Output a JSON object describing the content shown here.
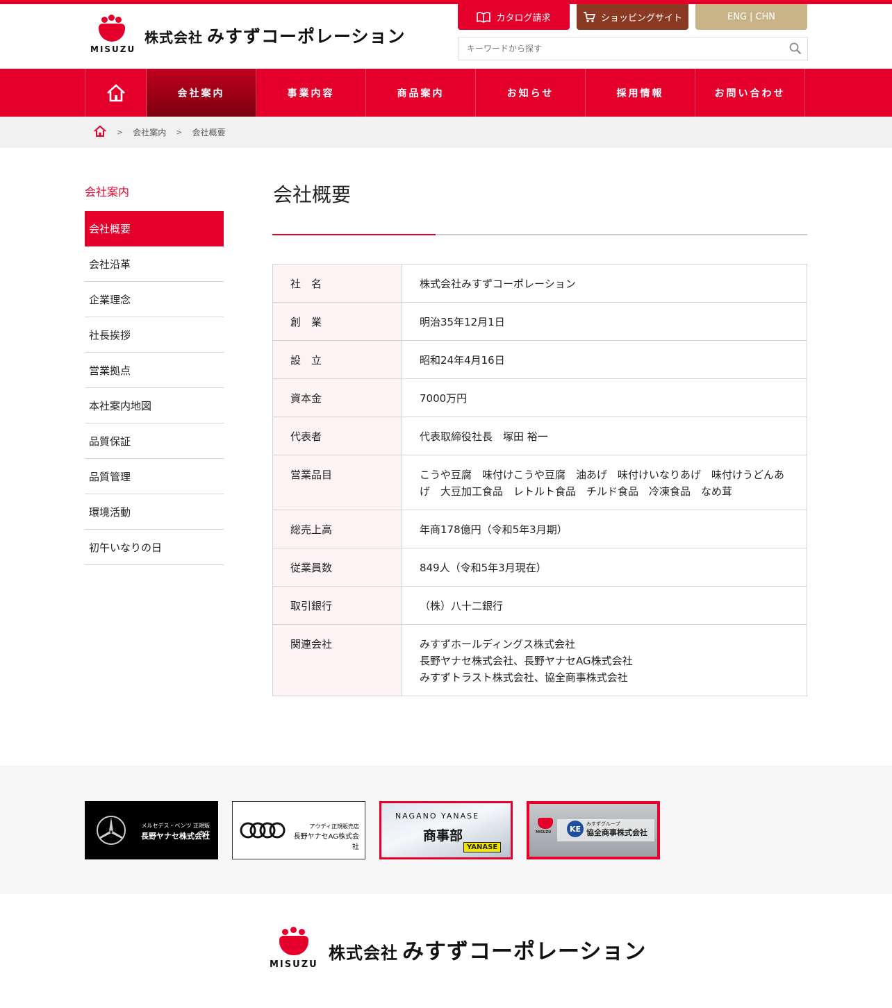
{
  "brand": {
    "mark_word": "MISUZU",
    "company_prefix": "株式会社",
    "company_name": "みすずコーポレーション",
    "accent_color": "#e4002b"
  },
  "header": {
    "catalog_label": "カタログ請求",
    "shop_label": "ショッピングサイト",
    "lang_eng": "ENG",
    "lang_sep": "|",
    "lang_chn": "CHN",
    "search_placeholder": "キーワードから探す"
  },
  "nav": {
    "items": [
      {
        "label": "会社案内",
        "active": true
      },
      {
        "label": "事業内容"
      },
      {
        "label": "商品案内"
      },
      {
        "label": "お知らせ"
      },
      {
        "label": "採用情報"
      },
      {
        "label": "お問い合わせ"
      }
    ]
  },
  "breadcrumb": {
    "sep": ">",
    "items": [
      "会社案内",
      "会社概要"
    ]
  },
  "sidebar": {
    "title": "会社案内",
    "items": [
      {
        "label": "会社概要",
        "active": true
      },
      {
        "label": "会社沿革"
      },
      {
        "label": "企業理念"
      },
      {
        "label": "社長挨拶"
      },
      {
        "label": "営業拠点"
      },
      {
        "label": "本社案内地図"
      },
      {
        "label": "品質保証"
      },
      {
        "label": "品質管理"
      },
      {
        "label": "環境活動"
      },
      {
        "label": "初午いなりの日"
      }
    ]
  },
  "main": {
    "title": "会社概要",
    "rows": [
      {
        "label": "社　名",
        "value": [
          "株式会社みすずコーポレーション"
        ]
      },
      {
        "label": "創　業",
        "value": [
          "明治35年12月1日"
        ]
      },
      {
        "label": "設　立",
        "value": [
          "昭和24年4月16日"
        ]
      },
      {
        "label": "資本金",
        "value": [
          "7000万円"
        ]
      },
      {
        "label": "代表者",
        "value": [
          "代表取締役社長　塚田 裕一"
        ]
      },
      {
        "label": "営業品目",
        "value": [
          "こうや豆腐　味付けこうや豆腐　油あげ　味付けいなりあげ　味付けうどんあげ　大豆加工食品　レトルト食品　チルド食品　冷凍食品　なめ茸"
        ]
      },
      {
        "label": "総売上高",
        "value": [
          "年商178億円（令和5年3月期）"
        ]
      },
      {
        "label": "従業員数",
        "value": [
          "849人（令和5年3月現在）"
        ]
      },
      {
        "label": "取引銀行",
        "value": [
          "（株）八十二銀行"
        ]
      },
      {
        "label": "関連会社",
        "value": [
          "みすずホールディングス株式会社",
          "長野ヤナセ株式会社、長野ヤナセAG株式会社",
          "みすずトラスト株式会社、協全商事株式会社"
        ]
      }
    ]
  },
  "banners": {
    "mercedes": {
      "sub": "メルセデス・ベンツ 正規販売店",
      "name": "長野ヤナセ株式会社"
    },
    "audi": {
      "sub": "アウディ正規販売店",
      "name": "長野ヤナセAG株式会社"
    },
    "yanase": {
      "top": "NAGANO YANASE",
      "main": "商事部",
      "badge": "YANASE"
    },
    "kyozen": {
      "mark_word": "MISUZU",
      "emblem": "KE",
      "sub": "みすずグループ",
      "name": "協全商事株式会社"
    }
  }
}
